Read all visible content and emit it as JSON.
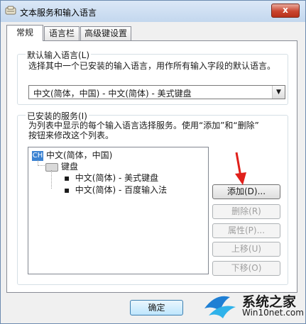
{
  "window": {
    "title": "文本服务和输入语言",
    "close_glyph": "x"
  },
  "tabs": [
    {
      "label": "常规",
      "active": true
    },
    {
      "label": "语言栏",
      "active": false
    },
    {
      "label": "高级键设置",
      "active": false
    }
  ],
  "default_language": {
    "group_title": "默认输入语言(L)",
    "description": "选择其中一个已安装的输入语言，用作所有输入字段的默认语言。",
    "selected": "中文(简体，中国) - 中文(简体) - 美式键盘"
  },
  "installed_services": {
    "group_title": "已安装的服务(I)",
    "description_line1": "为列表中显示的每个输入语言选择服务。使用“添加”和“删除”",
    "description_line2": "按钮来修改这个列表。",
    "tree": {
      "language_badge": "CH",
      "language": "中文(简体，中国)",
      "category": "键盘",
      "items": [
        "中文(简体) - 美式键盘",
        "中文(简体) - 百度输入法"
      ]
    },
    "buttons": {
      "add": "添加(D)...",
      "remove": "删除(R)",
      "properties": "属性(P)...",
      "move_up": "上移(U)",
      "move_down": "下移(O)"
    }
  },
  "footer": {
    "ok": "确定"
  },
  "watermark": {
    "name": "系统之家",
    "url": "Win10net.com"
  },
  "colors": {
    "accent": "#3c83d2",
    "arrow": "#e0201b"
  }
}
